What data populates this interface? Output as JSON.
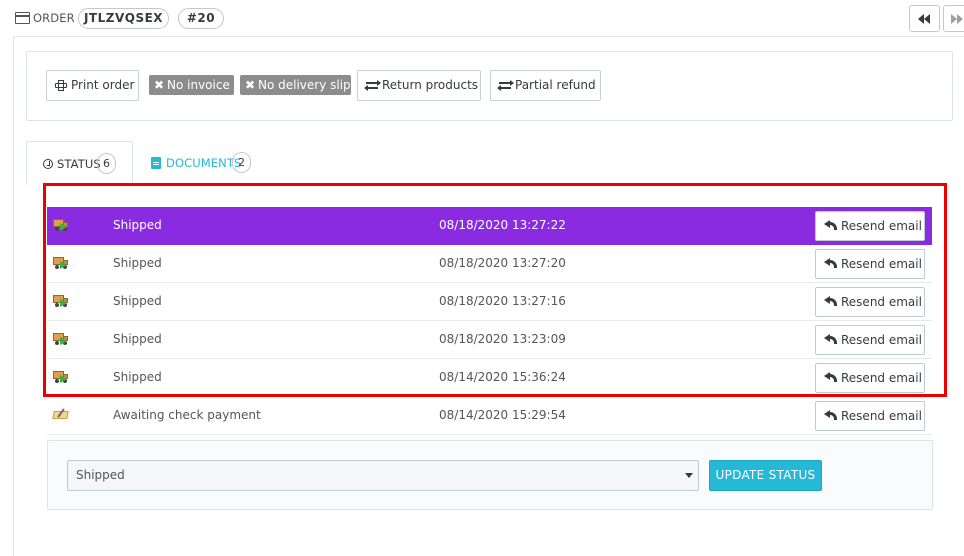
{
  "header": {
    "order_label": "ORDER",
    "reference": "JTLZVQSEX",
    "order_number": "#20",
    "nav_prev_icon": "backward-icon",
    "nav_next_icon": "forward-icon"
  },
  "toolbar": {
    "print_label": "Print order",
    "no_invoice_label": "No invoice",
    "no_slip_label": "No delivery slip",
    "return_label": "Return products",
    "refund_label": "Partial refund"
  },
  "tabs": {
    "status": {
      "label": "STATUS",
      "count": "6",
      "icon": "clock-icon"
    },
    "documents": {
      "label": "DOCUMENTS",
      "count": "2",
      "icon": "file-icon"
    }
  },
  "history": [
    {
      "status": "Shipped",
      "date": "08/18/2020 13:27:22",
      "icon": "truck-icon",
      "action": "Resend email",
      "highlight": true
    },
    {
      "status": "Shipped",
      "date": "08/18/2020 13:27:20",
      "icon": "truck-icon",
      "action": "Resend email"
    },
    {
      "status": "Shipped",
      "date": "08/18/2020 13:27:16",
      "icon": "truck-icon",
      "action": "Resend email"
    },
    {
      "status": "Shipped",
      "date": "08/18/2020 13:23:09",
      "icon": "truck-icon",
      "action": "Resend email"
    },
    {
      "status": "Shipped",
      "date": "08/14/2020 15:36:24",
      "icon": "truck-icon",
      "action": "Resend email"
    },
    {
      "status": "Awaiting check payment",
      "date": "08/14/2020 15:29:54",
      "icon": "cheque-icon",
      "action": "Resend email"
    }
  ],
  "update": {
    "selected_status": "Shipped",
    "button_label": "UPDATE STATUS"
  },
  "colors": {
    "highlight_row": "#8a2be2",
    "accent": "#25b9d7",
    "annotation_frame": "#ee0000",
    "badge_gray": "#8c8c8c"
  }
}
